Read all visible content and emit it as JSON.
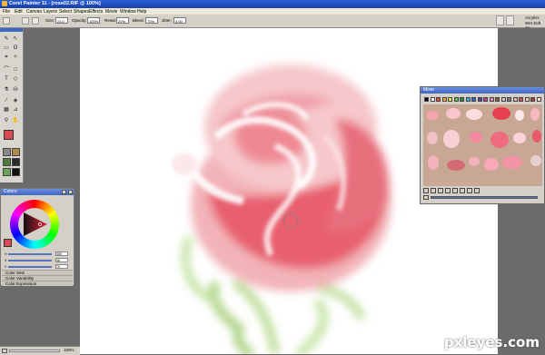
{
  "window": {
    "title": "Corel Painter 11 - [rose02.RIF @ 100%]"
  },
  "menu": {
    "items": [
      "File",
      "Edit",
      "Canvas",
      "Layers",
      "Select",
      "Shapes",
      "Effects",
      "Movie",
      "Window",
      "Help"
    ]
  },
  "propbar": {
    "size_label": "Size:",
    "size_value": "23.0",
    "opacity_label": "Opacity:",
    "opacity_value": "100%",
    "resat_label": "Resat:",
    "resat_value": "20%",
    "bleed_label": "Bleed:",
    "bleed_value": "70%",
    "jitter_label": "Jitter:",
    "jitter_value": "0.00",
    "category": "Acrylics",
    "variant": "Wet Soft Ac"
  },
  "colors_panel": {
    "title": "Colors",
    "rows": [
      {
        "label": "H",
        "value": "355"
      },
      {
        "label": "S",
        "value": "48"
      },
      {
        "label": "V",
        "value": "79"
      }
    ],
    "sections": [
      "Color Sets",
      "Color Variability",
      "Color Expression"
    ],
    "main_color": "#d94a57",
    "additional_color": "#f5f5f5"
  },
  "mixer": {
    "title": "Mixer",
    "swatches": [
      "#000000",
      "#ffffff",
      "#e84a3c",
      "#f2a33a",
      "#f6e23c",
      "#6cc24a",
      "#2d8a3e",
      "#3cb3d8",
      "#2f5fcf",
      "#5a3ca8",
      "#c33a9a",
      "#f28fb0",
      "#8a5a3a",
      "#c9c9c9",
      "#7d7d7d",
      "#e6b8b8",
      "#d94a57",
      "#f4c7c7",
      "#b33a3a",
      "#ffe0d0"
    ]
  },
  "status": {
    "zoom": "100%"
  },
  "watermark": "pxleyes.com",
  "colors": {
    "accent": "#3e66c4",
    "app_bg": "#6b6b6b",
    "canvas": "#ffffff"
  }
}
